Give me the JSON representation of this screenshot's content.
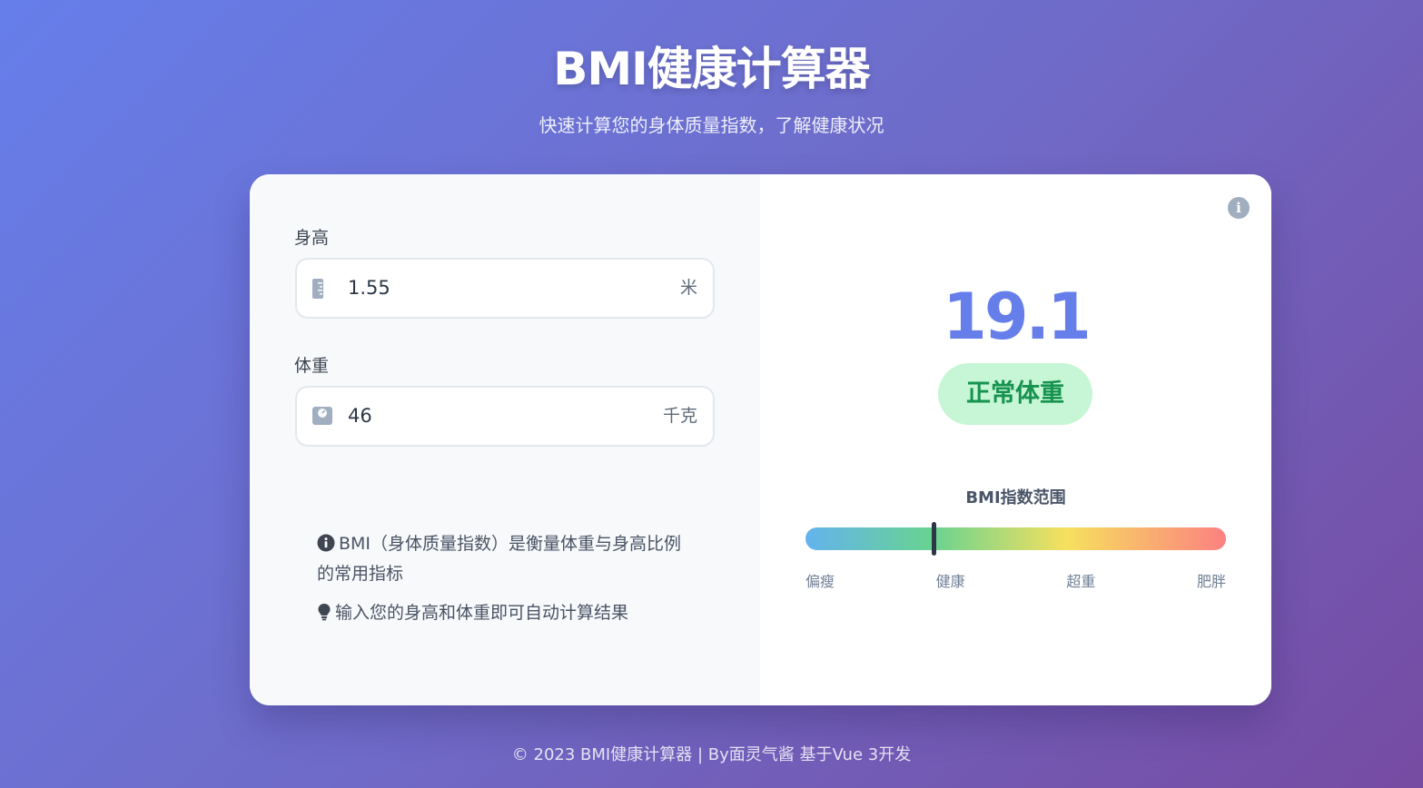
{
  "header": {
    "title": "BMI健康计算器",
    "subtitle": "快速计算您的身体质量指数，了解健康状况"
  },
  "form": {
    "height": {
      "label": "身高",
      "value": "1.55",
      "unit": "米",
      "icon": "ruler-icon"
    },
    "weight": {
      "label": "体重",
      "value": "46",
      "unit": "千克",
      "icon": "weight-scale-icon"
    }
  },
  "info": {
    "line1": "BMI（身体质量指数）是衡量体重与身高比例的常用指标",
    "line2": "输入您的身高和体重即可自动计算结果",
    "line1_icon": "info-circle-icon",
    "line2_icon": "lightbulb-icon"
  },
  "result": {
    "bmi": "19.1",
    "status": "正常体重",
    "info_icon": "info-icon"
  },
  "range": {
    "title": "BMI指数范围",
    "labels": [
      "偏瘦",
      "健康",
      "超重",
      "肥胖"
    ],
    "marker_fraction": 0.305
  },
  "footer": {
    "text": "© 2023 BMI健康计算器 | By面灵气酱 基于Vue 3开发"
  },
  "colors": {
    "accent": "#667eea",
    "status_bg": "#c6f6d5",
    "status_text": "#16934f"
  }
}
